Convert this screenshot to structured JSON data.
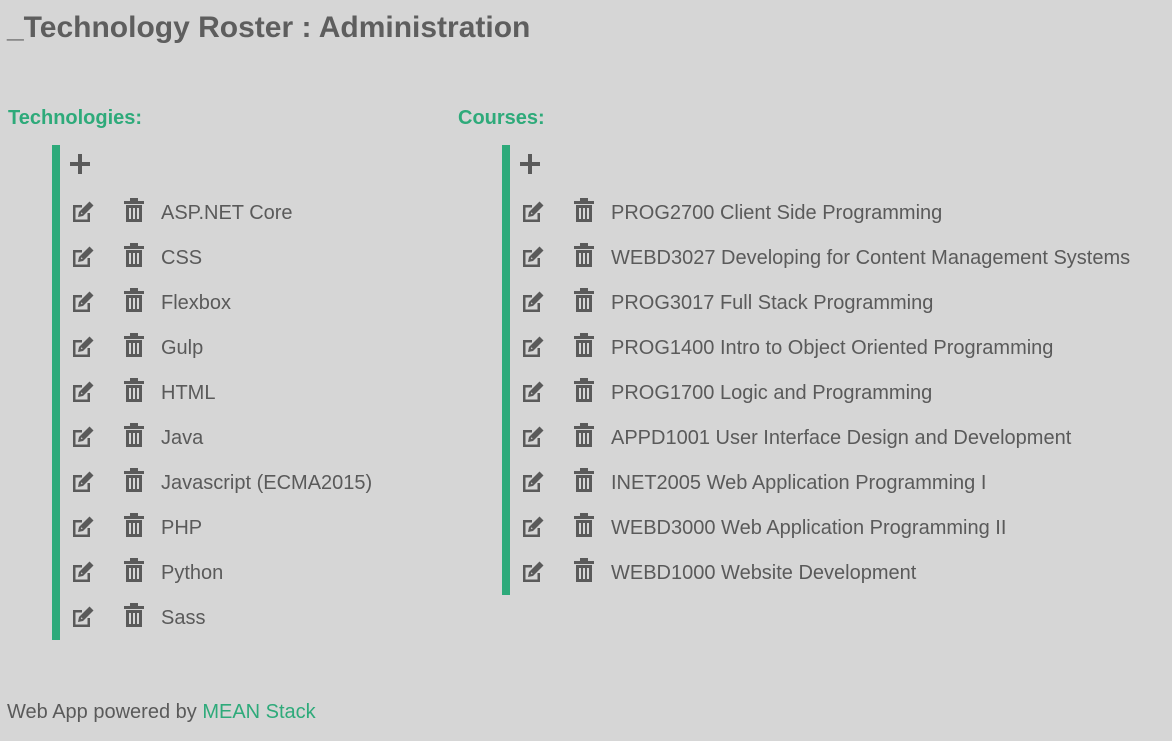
{
  "header": {
    "title": "_Technology Roster : Administration"
  },
  "technologies": {
    "heading": "Technologies:",
    "items": [
      {
        "label": "ASP.NET Core"
      },
      {
        "label": "CSS"
      },
      {
        "label": "Flexbox"
      },
      {
        "label": "Gulp"
      },
      {
        "label": "HTML"
      },
      {
        "label": "Java"
      },
      {
        "label": "Javascript (ECMA2015)"
      },
      {
        "label": "PHP"
      },
      {
        "label": "Python"
      },
      {
        "label": "Sass"
      }
    ]
  },
  "courses": {
    "heading": "Courses:",
    "items": [
      {
        "label": "PROG2700 Client Side Programming"
      },
      {
        "label": "WEBD3027 Developing for Content Management Systems"
      },
      {
        "label": "PROG3017 Full Stack Programming"
      },
      {
        "label": "PROG1400 Intro to Object Oriented Programming"
      },
      {
        "label": "PROG1700 Logic and Programming"
      },
      {
        "label": "APPD1001 User Interface Design and Development"
      },
      {
        "label": "INET2005 Web Application Programming I"
      },
      {
        "label": "WEBD3000 Web Application Programming II"
      },
      {
        "label": "WEBD1000 Website Development"
      }
    ]
  },
  "footer": {
    "prefix": "Web App powered by ",
    "link_text": "MEAN Stack"
  },
  "colors": {
    "accent": "#2eaa7a",
    "text": "#5a5a5a",
    "background": "#d6d6d6"
  },
  "icons": {
    "add": "plus-icon",
    "edit": "edit-icon",
    "delete": "trash-icon"
  }
}
